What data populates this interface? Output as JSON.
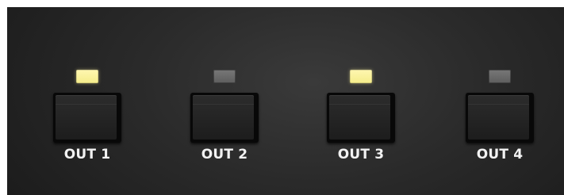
{
  "outputs": [
    {
      "label": "OUT 1",
      "led_state": "on",
      "led_color": "#f6ef93"
    },
    {
      "label": "OUT 2",
      "led_state": "off",
      "led_color": "#6a6a6a"
    },
    {
      "label": "OUT 3",
      "led_state": "on",
      "led_color": "#f6ef93"
    },
    {
      "label": "OUT 4",
      "led_state": "off",
      "led_color": "#6a6a6a"
    }
  ]
}
